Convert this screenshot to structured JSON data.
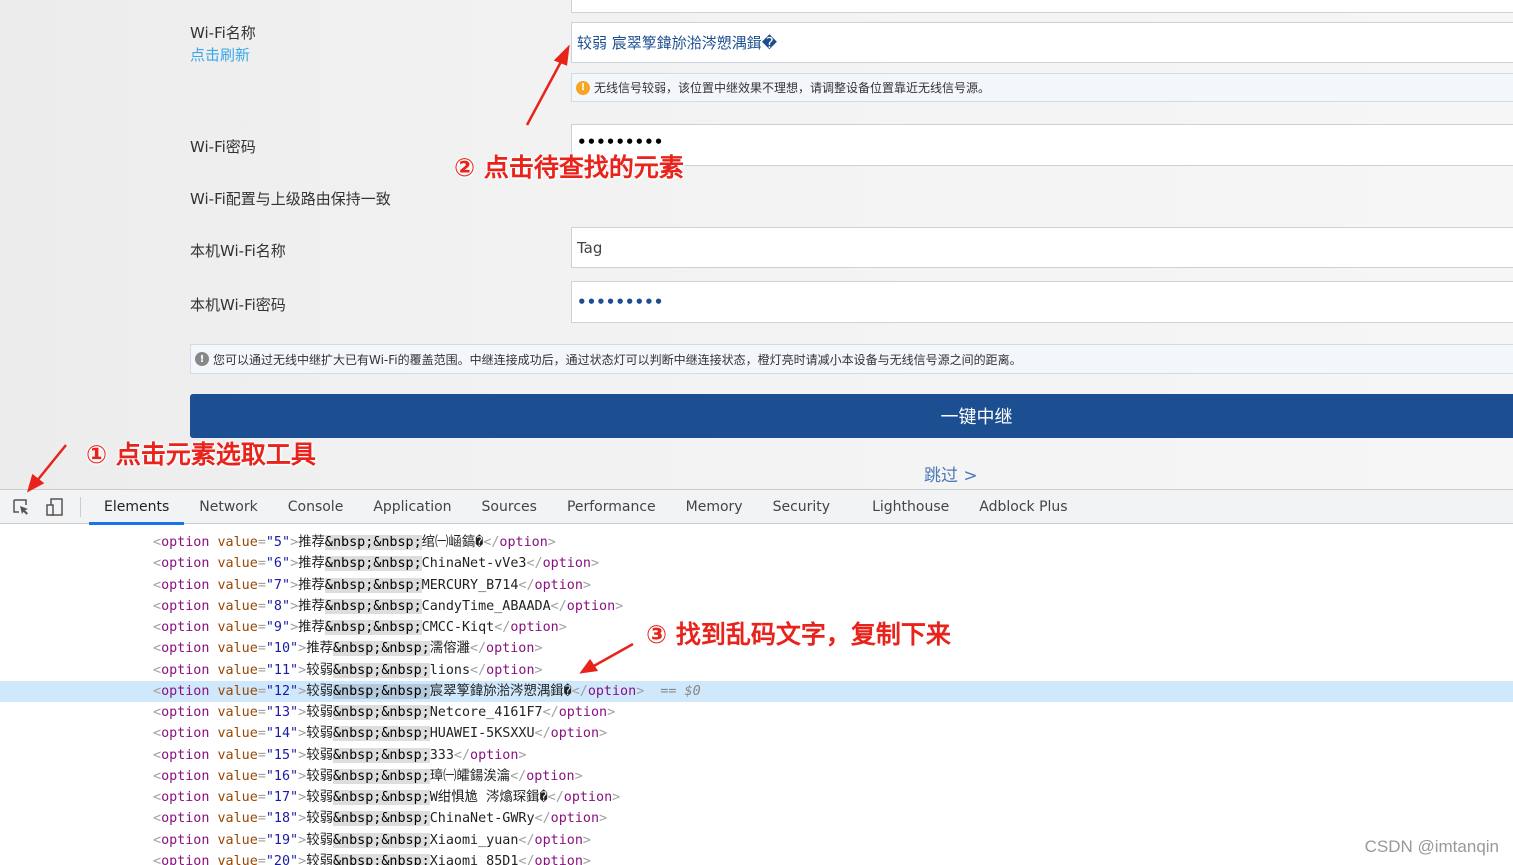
{
  "form": {
    "wifi_name_label": "Wi-Fi名称",
    "refresh_link": "点击刷新",
    "wifi_name_value": "较弱  宸翠箰鍏旀湁涔愬湡鍓�",
    "weak_signal_notice": "无线信号较弱，该位置中继效果不理想，请调整设备位置靠近无线信号源。",
    "wifi_password_label": "Wi-Fi密码",
    "wifi_password_value": "•••••••••",
    "sync_label": "Wi-Fi配置与上级路由保持一致",
    "local_name_label": "本机Wi-Fi名称",
    "local_name_value": "Tag",
    "local_password_label": "本机Wi-Fi密码",
    "local_password_value": "•••••••••",
    "info_notice": "您可以通过无线中继扩大已有Wi-Fi的覆盖范围。中继连接成功后，通过状态灯可以判断中继连接状态，橙灯亮时请减小本设备与无线信号源之间的距离。",
    "repeat_button": "一键中继",
    "skip_link": "跳过 >"
  },
  "annotations": {
    "step1": "① 点击元素选取工具",
    "step2": "② 点击待查找的元素",
    "step3": "③ 找到乱码文字，复制下来",
    "color": "#e8231b"
  },
  "devtools": {
    "tabs": [
      "Elements",
      "Network",
      "Console",
      "Application",
      "Sources",
      "Performance",
      "Memory",
      "Security",
      "Lighthouse",
      "Adblock Plus"
    ],
    "active_tab": "Elements",
    "selected_suffix": "== $0",
    "options": [
      {
        "value": "5",
        "prefix": "推荐",
        "name": "绾㈠崡鎬�"
      },
      {
        "value": "6",
        "prefix": "推荐",
        "name": "ChinaNet-vVe3"
      },
      {
        "value": "7",
        "prefix": "推荐",
        "name": "MERCURY_B714"
      },
      {
        "value": "8",
        "prefix": "推荐",
        "name": "CandyTime_ABAADA"
      },
      {
        "value": "9",
        "prefix": "推荐",
        "name": "CMCC-Kiqt"
      },
      {
        "value": "10",
        "prefix": "推荐",
        "name": "濡傛灉"
      },
      {
        "value": "11",
        "prefix": "较弱",
        "name": "lions"
      },
      {
        "value": "12",
        "prefix": "较弱",
        "name": "宸翠箰鍏旀湁涔愬湡鍓�",
        "selected": true
      },
      {
        "value": "13",
        "prefix": "较弱",
        "name": "Netcore_4161F7"
      },
      {
        "value": "14",
        "prefix": "较弱",
        "name": "HUAWEI-5KSXXU"
      },
      {
        "value": "15",
        "prefix": "较弱",
        "name": "333"
      },
      {
        "value": "16",
        "prefix": "较弱",
        "name": "璋㈠皬鍚涘瀹"
      },
      {
        "value": "17",
        "prefix": "较弱",
        "name": "W绀惧尯 涔熻琛鍓�"
      },
      {
        "value": "18",
        "prefix": "较弱",
        "name": "ChinaNet-GWRy"
      },
      {
        "value": "19",
        "prefix": "较弱",
        "name": "Xiaomi_yuan"
      },
      {
        "value": "20",
        "prefix": "较弱",
        "name": "Xiaomi_85D1"
      }
    ],
    "nbsp": "&nbsp;&nbsp;"
  },
  "watermark": "CSDN @imtanqin"
}
